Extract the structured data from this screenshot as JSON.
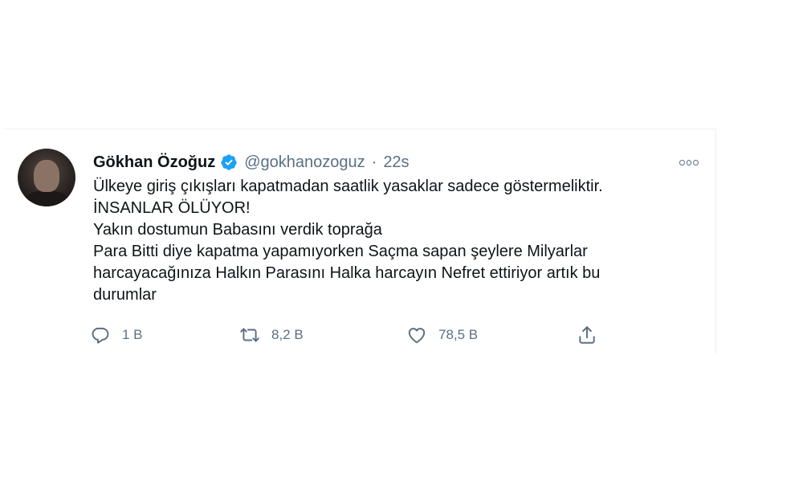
{
  "tweet": {
    "author_name": "Gökhan Özoğuz",
    "handle": "@gokhanozoguz",
    "separator": "·",
    "time": "22s",
    "verified": true,
    "lines": [
      "Ülkeye giriş çıkışları kapatmadan saatlik yasaklar sadece göstermeliktir.",
      "İNSANLAR ÖLÜYOR!",
      "Yakın dostumun Babasını verdik toprağa",
      "Para Bitti diye kapatma yapamıyorken Saçma sapan şeylere Milyarlar",
      "harcayacağınıza Halkın Parasını Halka harcayın Nefret ettiriyor artık bu",
      "durumlar"
    ],
    "actions": {
      "reply": {
        "icon": "reply-icon",
        "count": "1 B"
      },
      "retweet": {
        "icon": "retweet-icon",
        "count": "8,2 B"
      },
      "like": {
        "icon": "heart-icon",
        "count": "78,5 B"
      },
      "share": {
        "icon": "share-icon"
      }
    }
  },
  "colors": {
    "text": "#0f1419",
    "secondary": "#5b7083",
    "verified": "#1da1f2",
    "border": "#ebeef0"
  }
}
